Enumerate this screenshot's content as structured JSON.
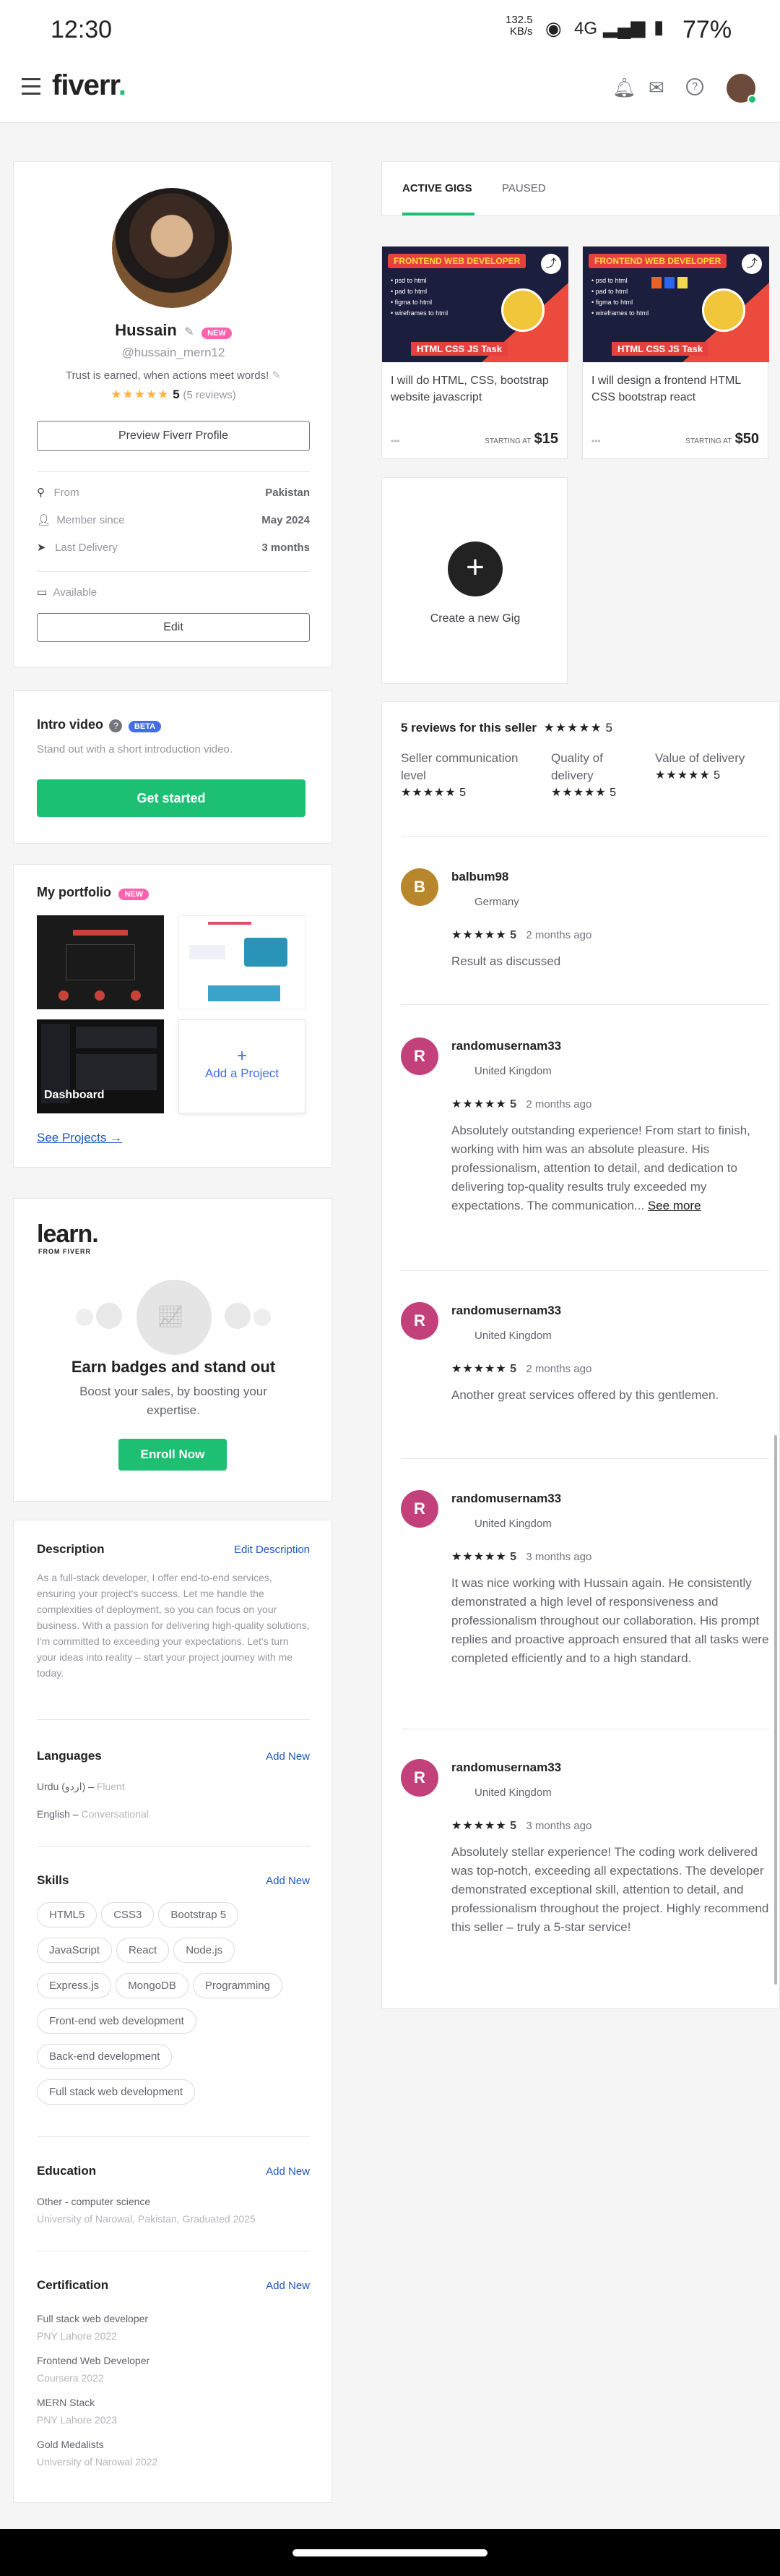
{
  "status": {
    "time": "12:30",
    "speed": "132.5\nKB/s",
    "network": "4G",
    "battery": "77%"
  },
  "nav": {
    "logo": "fiverr",
    "logo_dot": "."
  },
  "profile": {
    "name": "Hussain",
    "new_badge": "NEW",
    "username": "@hussain_mern12",
    "tagline": "Trust is earned, when actions meet words!",
    "rating": "5",
    "reviews": "(5 reviews)",
    "preview_button": "Preview Fiverr Profile",
    "from_label": "From",
    "from_value": "Pakistan",
    "member_label": "Member since",
    "member_value": "May 2024",
    "delivery_label": "Last Delivery",
    "delivery_value": "3 months",
    "available": "Available",
    "edit_button": "Edit"
  },
  "intro": {
    "title": "Intro video",
    "badge": "BETA",
    "subtitle": "Stand out with a short introduction video.",
    "button": "Get started"
  },
  "portfolio": {
    "title": "My portfolio",
    "badge": "NEW",
    "dashboard_label": "Dashboard",
    "add_plus": "+",
    "add_label": "Add a Project",
    "see_projects": "See Projects"
  },
  "learn": {
    "logo": "learn.",
    "logo_sub": "FROM FIVERR",
    "title": "Earn badges and stand out",
    "subtitle": "Boost your sales, by boosting your expertise.",
    "button": "Enroll Now"
  },
  "description": {
    "title": "Description",
    "edit": "Edit Description",
    "text": "As a full-stack developer, I offer end-to-end services, ensuring your project's success. Let me handle the complexities of deployment, so you can focus on your business. With a passion for delivering high-quality solutions, I'm committed to exceeding your expectations. Let's turn your ideas into reality – start your project journey with me today."
  },
  "languages": {
    "title": "Languages",
    "add": "Add New",
    "items": [
      {
        "name": "Urdu (اردو)",
        "level": "Fluent"
      },
      {
        "name": "English",
        "level": "Conversational"
      }
    ]
  },
  "skills": {
    "title": "Skills",
    "add": "Add New",
    "items": [
      "HTML5",
      "CSS3",
      "Bootstrap 5",
      "JavaScript",
      "React",
      "Node.js",
      "Express.js",
      "MongoDB",
      "Programming",
      "Front-end web development",
      "Back-end development",
      "Full stack web development"
    ]
  },
  "education": {
    "title": "Education",
    "add": "Add New",
    "degree": "Other - computer science",
    "school": "University of Narowal, Pakistan, Graduated 2025"
  },
  "certification": {
    "title": "Certification",
    "add": "Add New",
    "items": [
      {
        "name": "Full stack web developer",
        "org": "PNY Lahore 2022"
      },
      {
        "name": "Frontend Web Developer",
        "org": "Coursera 2022"
      },
      {
        "name": "MERN Stack",
        "org": "PNY Lahore 2023"
      },
      {
        "name": "Gold Medalists",
        "org": "University of Narowal 2022"
      }
    ]
  },
  "tabs": {
    "active": "ACTIVE GIGS",
    "paused": "PAUSED"
  },
  "gigs": [
    {
      "banner": "FRONTEND WEB DEVELOPER",
      "bullets": [
        "psd to html",
        "pad to html",
        "figma to html",
        "wireframes to html"
      ],
      "task": "HTML CSS JS Task",
      "title": "I will do HTML, CSS, bootstrap website javascript",
      "dots": "•••",
      "starting": "STARTING AT",
      "price": "$15"
    },
    {
      "banner": "FRONTEND WEB DEVELOPER",
      "bullets": [
        "psd to html",
        "pad to html",
        "figma to html",
        "wireframes to html"
      ],
      "task": "HTML CSS JS Task",
      "title": "I will design a frontend HTML CSS bootstrap react",
      "dots": "•••",
      "starting": "STARTING AT",
      "price": "$50"
    }
  ],
  "create_gig": {
    "plus": "+",
    "label": "Create a new Gig"
  },
  "reviews_summary": {
    "title": "5 reviews for this seller",
    "rating": "5",
    "cats": [
      {
        "label": "Seller communication level",
        "rating": "5"
      },
      {
        "label": "Quality of delivery",
        "rating": "5"
      },
      {
        "label": "Value of delivery",
        "rating": "5"
      }
    ]
  },
  "reviews": [
    {
      "initial": "B",
      "color": "#b8862b",
      "name": "balbum98",
      "country": "Germany",
      "rating": "5",
      "time": "2 months ago",
      "text": "Result as discussed",
      "more": ""
    },
    {
      "initial": "R",
      "color": "#c2417a",
      "name": "randomusernam33",
      "country": "United Kingdom",
      "rating": "5",
      "time": "2 months ago",
      "text": "Absolutely outstanding experience! From start to finish, working with him was an absolute pleasure. His professionalism, attention to detail, and dedication to delivering top-quality results truly exceeded my expectations. The communication...",
      "more": "See more"
    },
    {
      "initial": "R",
      "color": "#c2417a",
      "name": "randomusernam33",
      "country": "United Kingdom",
      "rating": "5",
      "time": "2 months ago",
      "text": "Another great services offered by this gentlemen.",
      "more": ""
    },
    {
      "initial": "R",
      "color": "#c2417a",
      "name": "randomusernam33",
      "country": "United Kingdom",
      "rating": "5",
      "time": "3 months ago",
      "text": "It was nice working with Hussain again. He consistently demonstrated a high level of responsiveness and professionalism throughout our collaboration. His prompt replies and proactive approach ensured that all tasks were completed efficiently and to a high standard.",
      "more": ""
    },
    {
      "initial": "R",
      "color": "#c2417a",
      "name": "randomusernam33",
      "country": "United Kingdom",
      "rating": "5",
      "time": "3 months ago",
      "text": "Absolutely stellar experience! The coding work delivered was top-notch, exceeding all expectations. The developer demonstrated exceptional skill, attention to detail, and professionalism throughout the project. Highly recommend this seller – truly a 5-star service!",
      "more": ""
    }
  ]
}
